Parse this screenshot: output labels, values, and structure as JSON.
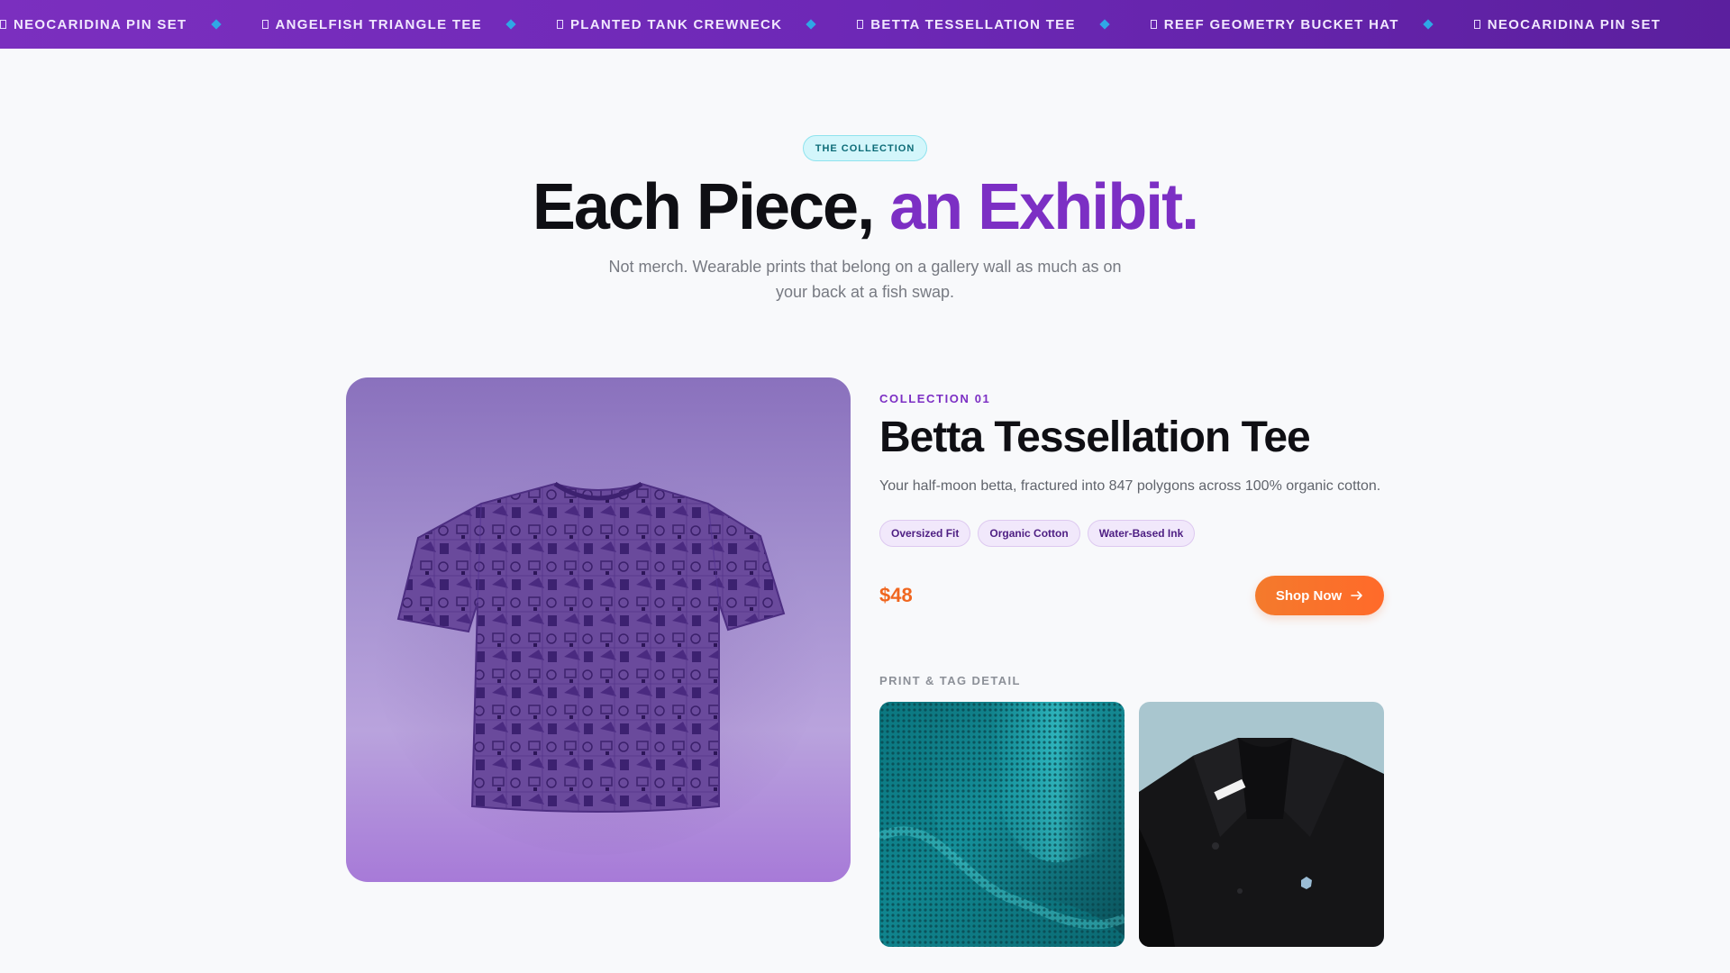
{
  "ticker": {
    "items": [
      "NEOCARIDINA PIN SET",
      "ANGELFISH TRIANGLE TEE",
      "PLANTED TANK CREWNECK",
      "BETTA TESSELLATION TEE",
      "REEF GEOMETRY BUCKET HAT",
      "NEOCARIDINA PIN SET"
    ],
    "separator_color": "#2fa7e6"
  },
  "hero": {
    "badge": "THE COLLECTION",
    "title_main": "Each Piece,",
    "title_accent": "an Exhibit.",
    "subtitle": "Not merch. Wearable prints that belong on a gallery wall as much as on your back at a fish swap.",
    "accent_color": "#7c2fc4"
  },
  "product": {
    "collection": "COLLECTION 01",
    "name": "Betta Tessellation Tee",
    "description": "Your half-moon betta, fractured into 847 polygons across 100% organic cotton.",
    "tags": [
      "Oversized Fit",
      "Organic Cotton",
      "Water-Based Ink"
    ],
    "price": "$48",
    "price_color": "#f0661f",
    "cta": "Shop Now",
    "cta_icon": "arrow-right-icon",
    "detail_label": "PRINT & TAG DETAIL"
  }
}
